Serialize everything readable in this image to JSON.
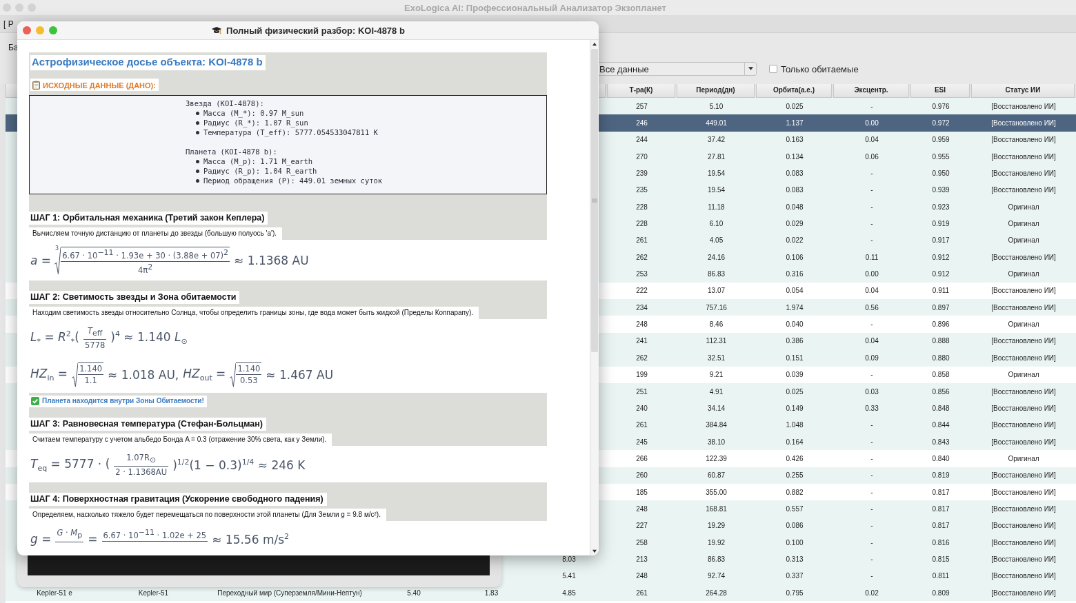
{
  "main_window": {
    "title": "ExoLogica AI: Профессиональный Анализатор Экзопланет",
    "tab_label": "[ P",
    "panel_label": "Ба"
  },
  "filter": {
    "dropdown": "Все данные",
    "checkbox": {
      "label": "Только обитаемые",
      "checked": false
    }
  },
  "table": {
    "columns": [
      "Т-ра(К)",
      "Период(дн)",
      "Орбита(а.е.)",
      "Эксцентр.",
      "ESI",
      "Статус ИИ"
    ],
    "rows": [
      {
        "selected": false,
        "tinted": true,
        "temp": "257",
        "period": "5.10",
        "orbit": "0.025",
        "ecc": "-",
        "esi": "0.976",
        "status": "[Восстановлено ИИ]"
      },
      {
        "selected": true,
        "temp": "246",
        "period": "449.01",
        "orbit": "1.137",
        "ecc": "0.00",
        "esi": "0.972",
        "status": "[Восстановлено ИИ]"
      },
      {
        "selected": false,
        "tinted": true,
        "temp": "244",
        "period": "37.42",
        "orbit": "0.163",
        "ecc": "0.04",
        "esi": "0.959",
        "status": "[Восстановлено ИИ]"
      },
      {
        "selected": false,
        "tinted": true,
        "temp": "270",
        "period": "27.81",
        "orbit": "0.134",
        "ecc": "0.06",
        "esi": "0.955",
        "status": "[Восстановлено ИИ]"
      },
      {
        "selected": false,
        "tinted": true,
        "temp": "239",
        "period": "19.54",
        "orbit": "0.083",
        "ecc": "-",
        "esi": "0.950",
        "status": "[Восстановлено ИИ]"
      },
      {
        "selected": false,
        "tinted": true,
        "temp": "235",
        "period": "19.54",
        "orbit": "0.083",
        "ecc": "-",
        "esi": "0.939",
        "status": "[Восстановлено ИИ]"
      },
      {
        "selected": false,
        "tinted": true,
        "temp": "228",
        "period": "11.18",
        "orbit": "0.048",
        "ecc": "-",
        "esi": "0.923",
        "status": "Оригинал"
      },
      {
        "selected": false,
        "tinted": true,
        "temp": "228",
        "period": "6.10",
        "orbit": "0.029",
        "ecc": "-",
        "esi": "0.919",
        "status": "Оригинал"
      },
      {
        "selected": false,
        "tinted": true,
        "temp": "261",
        "period": "4.05",
        "orbit": "0.022",
        "ecc": "-",
        "esi": "0.917",
        "status": "Оригинал"
      },
      {
        "selected": false,
        "tinted": true,
        "temp": "262",
        "period": "24.16",
        "orbit": "0.106",
        "ecc": "0.11",
        "esi": "0.912",
        "status": "[Восстановлено ИИ]"
      },
      {
        "selected": false,
        "tinted": true,
        "temp": "253",
        "period": "86.83",
        "orbit": "0.316",
        "ecc": "0.00",
        "esi": "0.912",
        "status": "Оригинал"
      },
      {
        "selected": false,
        "tinted": false,
        "temp": "222",
        "period": "13.07",
        "orbit": "0.054",
        "ecc": "0.04",
        "esi": "0.911",
        "status": "[Восстановлено ИИ]"
      },
      {
        "selected": false,
        "tinted": true,
        "temp": "234",
        "period": "757.16",
        "orbit": "1.974",
        "ecc": "0.56",
        "esi": "0.897",
        "status": "[Восстановлено ИИ]"
      },
      {
        "selected": false,
        "tinted": false,
        "temp": "248",
        "period": "8.46",
        "orbit": "0.040",
        "ecc": "-",
        "esi": "0.896",
        "status": "Оригинал"
      },
      {
        "selected": false,
        "tinted": true,
        "temp": "241",
        "period": "112.31",
        "orbit": "0.386",
        "ecc": "0.04",
        "esi": "0.888",
        "status": "[Восстановлено ИИ]"
      },
      {
        "selected": false,
        "tinted": true,
        "temp": "262",
        "period": "32.51",
        "orbit": "0.151",
        "ecc": "0.09",
        "esi": "0.880",
        "status": "[Восстановлено ИИ]"
      },
      {
        "selected": false,
        "tinted": false,
        "temp": "199",
        "period": "9.21",
        "orbit": "0.039",
        "ecc": "-",
        "esi": "0.858",
        "status": "Оригинал"
      },
      {
        "selected": false,
        "tinted": true,
        "temp": "251",
        "period": "4.91",
        "orbit": "0.025",
        "ecc": "0.03",
        "esi": "0.856",
        "status": "[Восстановлено ИИ]"
      },
      {
        "selected": false,
        "tinted": true,
        "temp": "240",
        "period": "34.14",
        "orbit": "0.149",
        "ecc": "0.33",
        "esi": "0.848",
        "status": "[Восстановлено ИИ]"
      },
      {
        "selected": false,
        "tinted": true,
        "temp": "261",
        "period": "384.84",
        "orbit": "1.048",
        "ecc": "-",
        "esi": "0.844",
        "status": "[Восстановлено ИИ]"
      },
      {
        "selected": false,
        "tinted": true,
        "temp": "245",
        "period": "38.10",
        "orbit": "0.164",
        "ecc": "-",
        "esi": "0.843",
        "status": "[Восстановлено ИИ]"
      },
      {
        "selected": false,
        "tinted": false,
        "temp": "266",
        "period": "122.39",
        "orbit": "0.426",
        "ecc": "-",
        "esi": "0.840",
        "status": "Оригинал"
      },
      {
        "selected": false,
        "tinted": true,
        "temp": "260",
        "period": "60.87",
        "orbit": "0.255",
        "ecc": "-",
        "esi": "0.819",
        "status": "[Восстановлено ИИ]"
      },
      {
        "selected": false,
        "tinted": false,
        "temp": "185",
        "period": "355.00",
        "orbit": "0.882",
        "ecc": "-",
        "esi": "0.817",
        "status": "[Восстановлено ИИ]"
      },
      {
        "selected": false,
        "tinted": true,
        "temp": "248",
        "period": "168.81",
        "orbit": "0.557",
        "ecc": "-",
        "esi": "0.817",
        "status": "[Восстановлено ИИ]"
      },
      {
        "selected": false,
        "tinted": true,
        "temp": "227",
        "period": "19.29",
        "orbit": "0.086",
        "ecc": "-",
        "esi": "0.817",
        "status": "[Восстановлено ИИ]"
      },
      {
        "selected": false,
        "tinted": true,
        "temp": "258",
        "period": "19.92",
        "orbit": "0.100",
        "ecc": "-",
        "esi": "0.816",
        "status": "[Восстановлено ИИ]"
      },
      {
        "selected": false,
        "tinted": true,
        "column_6": "8.03",
        "temp": "213",
        "period": "86.83",
        "orbit": "0.313",
        "ecc": "-",
        "esi": "0.815",
        "status": "[Восстановлено ИИ]"
      },
      {
        "selected": false,
        "tinted": true,
        "column_6": "5.41",
        "temp": "248",
        "period": "92.74",
        "orbit": "0.337",
        "ecc": "-",
        "esi": "0.811",
        "status": "[Восстановлено ИИ]"
      },
      {
        "selected": false,
        "tinted": true,
        "name": "Kepler-51 e",
        "star": "Kepler-51",
        "type": "Переходный мир (Суперземля/Мини-Нептун)",
        "column_4": "5.40",
        "column_5": "1.83",
        "column_6": "4.85",
        "temp": "261",
        "period": "264.28",
        "orbit": "0.795",
        "ecc": "0.02",
        "esi": "0.809",
        "status": "[Восстановлено ИИ]"
      }
    ]
  },
  "dialog": {
    "title": "Полный физический разбор: KOI-4878 b",
    "heading": "Астрофизическое досье объекта: KOI-4878 b",
    "given_label": "ИСХОДНЫЕ ДАННЫЕ (ДАНО):",
    "given": [
      {
        "title": "Звезда (KOI-4878):",
        "items": [
          "Масса (M_*): 0.97 M_sun",
          "Радиус (R_*): 1.07 R_sun",
          "Температура (T_eff): 5777.054533047811 K"
        ]
      },
      {
        "title": "Планета (KOI-4878 b):",
        "items": [
          "Масса (M_p): 1.71 M_earth",
          "Радиус (R_p): 1.04 R_earth",
          "Период обращения (P): 449.01 земных суток"
        ]
      }
    ],
    "steps": [
      {
        "title": "ШАГ 1: Орбитальная механика (Третий закон Кеплера)",
        "description": "Вычисляем точную дистанцию от планеты до звезды (большую полуось 'a').",
        "formulas": [
          [
            {
              "kind": "text",
              "text": "*a* ="
            },
            {
              "kind": "root",
              "index": "3",
              "num": "6.67 · 10$^{−11}$ · 1.93e + 30 · (3.88e + 07)$^{2}$",
              "den": "4π$^{2}$"
            },
            {
              "kind": "text",
              "text": "≈ 1.1368 AU"
            }
          ]
        ]
      },
      {
        "title": "ШАГ 2: Светимость звезды и Зона обитаемости",
        "description": "Находим светимость звезды относительно Солнца, чтобы определить границы зоны, где вода может быть жидкой (Пределы Коппарапу).",
        "formulas": [
          [
            {
              "kind": "text",
              "text": "*L*$_{*}$ = *R*$^{2}$$_{*}$("
            },
            {
              "kind": "frac",
              "num": "*T*$_{eff}$",
              "den": "5778"
            },
            {
              "kind": "text",
              "text": ")$^{4}$ ≈ 1.140 *L*$_{⊙}$"
            }
          ],
          [
            {
              "kind": "text",
              "text": "*HZ*$_{in}$ ="
            },
            {
              "kind": "root",
              "num": "1.140",
              "den": "1.1"
            },
            {
              "kind": "text",
              "text": "≈ 1.018 AU,"
            },
            {
              "kind": "text",
              "text": "*HZ*$_{out}$ ="
            },
            {
              "kind": "root",
              "num": "1.140",
              "den": "0.53"
            },
            {
              "kind": "text",
              "text": "≈ 1.467 AU"
            }
          ]
        ],
        "note": "Планета находится внутри Зоны Обитаемости!"
      },
      {
        "title": "ШАГ 3: Равновесная температура (Стефан-Больцман)",
        "description": "Считаем температуру с учетом альбедо Бонда A = 0.3 (отражение 30% света, как у Земли).",
        "formulas": [
          [
            {
              "kind": "text",
              "text": "*T*$_{eq}$ = 5777 · ("
            },
            {
              "kind": "frac",
              "num": "1.07R$_{⊙}$",
              "den": "2 · 1.1368AU"
            },
            {
              "kind": "text",
              "text": ")$^{1/2}$(1 − 0.3)$^{1/4}$ ≈ 246 K"
            }
          ]
        ]
      },
      {
        "title": "ШАГ 4: Поверхностная гравитация (Ускорение свободного падения)",
        "description": "Определяем, насколько тяжело будет перемещаться по поверхности этой планеты (Для Земли g = 9.8 м/с²).",
        "formulas": [
          [
            {
              "kind": "text",
              "text": "*g* ="
            },
            {
              "kind": "frac",
              "num": "*G* · *M*$_{p}$"
            },
            {
              "kind": "text",
              "text": "="
            },
            {
              "kind": "frac",
              "num": "6.67 · 10$^{−11}$ · 1.02e + 25"
            },
            {
              "kind": "text",
              "text": "≈ 15.56 m/s$^{2}$"
            }
          ]
        ]
      }
    ]
  }
}
